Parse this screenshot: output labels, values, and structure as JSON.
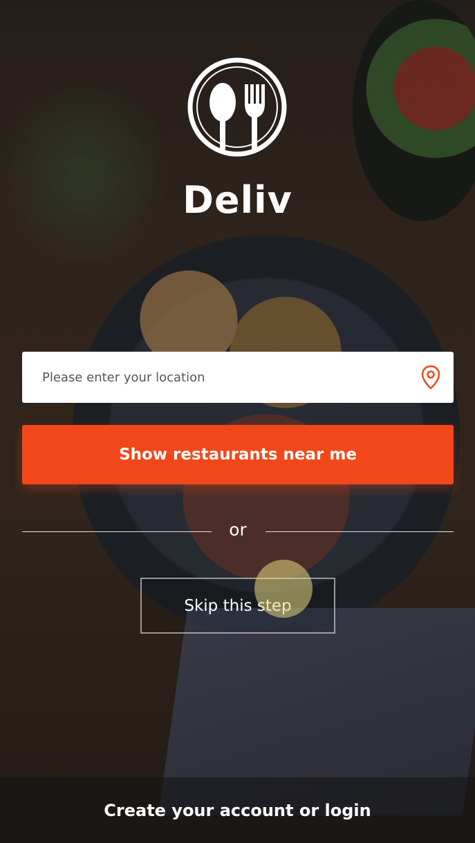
{
  "brand": {
    "name": "Deliv",
    "logo_icon": "spoon-fork-icon"
  },
  "location": {
    "placeholder": "Please enter your location",
    "value": "",
    "icon": "location-pin-icon"
  },
  "primary_button": {
    "label": "Show restaurants near me"
  },
  "divider": {
    "label": "or"
  },
  "skip_button": {
    "label": "Skip this step"
  },
  "footer": {
    "label": "Create your account or login"
  },
  "colors": {
    "accent": "#F2471A",
    "text": "#FFFFFF"
  }
}
